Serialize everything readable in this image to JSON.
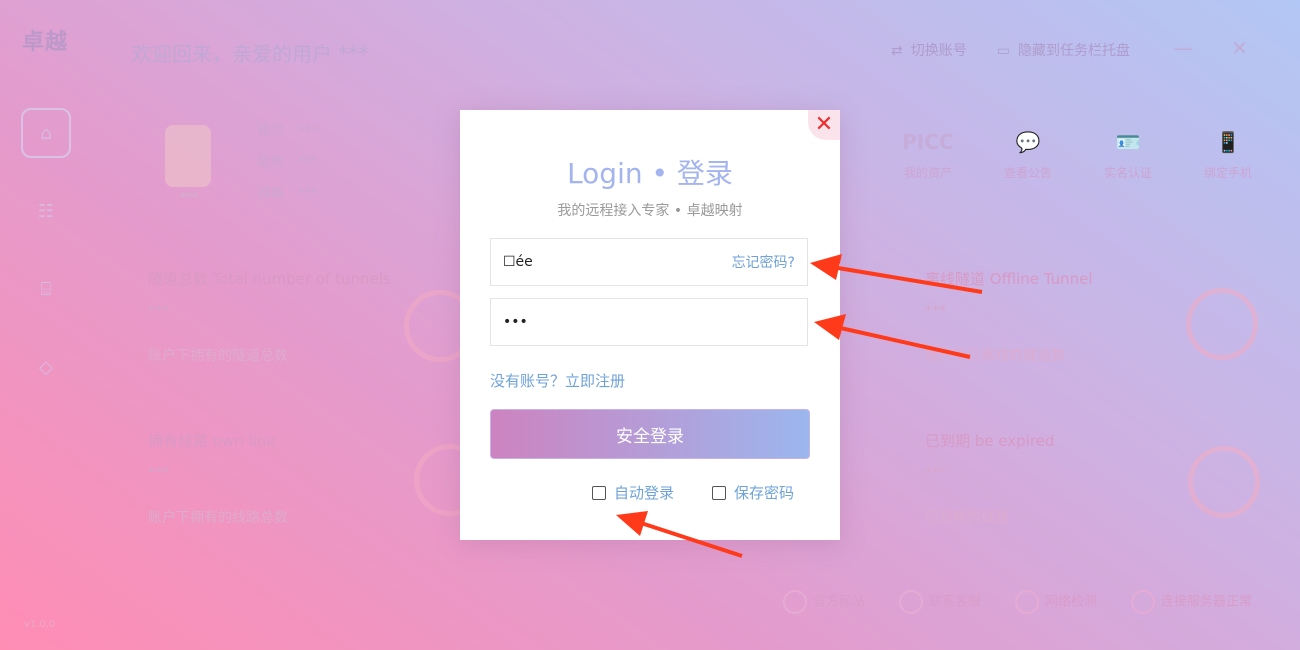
{
  "app": {
    "brand": "卓越",
    "welcome": "欢迎回来，亲爱的用户 ***",
    "switch_account": "切换账号",
    "hide_to_tray": "隐藏到任务栏托盘",
    "minimize_glyph": "—",
    "close_glyph": "✕",
    "version": "v1.0.0"
  },
  "profile": {
    "avatar_name": "***",
    "fields": [
      {
        "label": "账号",
        "value": "***"
      },
      {
        "label": "昵称",
        "value": "***"
      },
      {
        "label": "邮箱",
        "value": "***"
      }
    ]
  },
  "quick": [
    {
      "icon": "PICC",
      "label": "我的资产"
    },
    {
      "icon": "💬",
      "label": "查看公告"
    },
    {
      "icon": "🪪",
      "label": "实名认证"
    },
    {
      "icon": "📱",
      "label": "绑定手机"
    }
  ],
  "tiles": [
    {
      "title": "隧道总数 Total number of tunnels",
      "value": "***",
      "desc": "账户下拥有的隧道总数"
    },
    {
      "title": "离线隧道 Offline Tunnel",
      "value": "***",
      "desc": "账户下已离线的隧道数"
    },
    {
      "title": "拥有线路 own line",
      "value": "***",
      "desc": "账户下拥有的线路总数"
    },
    {
      "title": "已到期 be expired",
      "value": "***",
      "desc": "已到期的线路"
    }
  ],
  "footer": {
    "website": "官方网站",
    "support": "联系客服",
    "network_check": "网络检测",
    "server_status": "连接服务器正常"
  },
  "login": {
    "title": "Login • 登录",
    "subtitle": "我的远程接入专家 • 卓越映射",
    "username_value": "☐ée",
    "forgot": "忘记密码?",
    "password_value": "•••",
    "register": "没有账号？立即注册",
    "submit": "安全登录",
    "auto_login": "自动登录",
    "save_password": "保存密码",
    "close": "✕"
  },
  "colors": {
    "accent": "#6fa2d8",
    "title": "#a4b4ee",
    "close": "#ef2b2b",
    "annotation_arrow": "#ff3a1a"
  }
}
